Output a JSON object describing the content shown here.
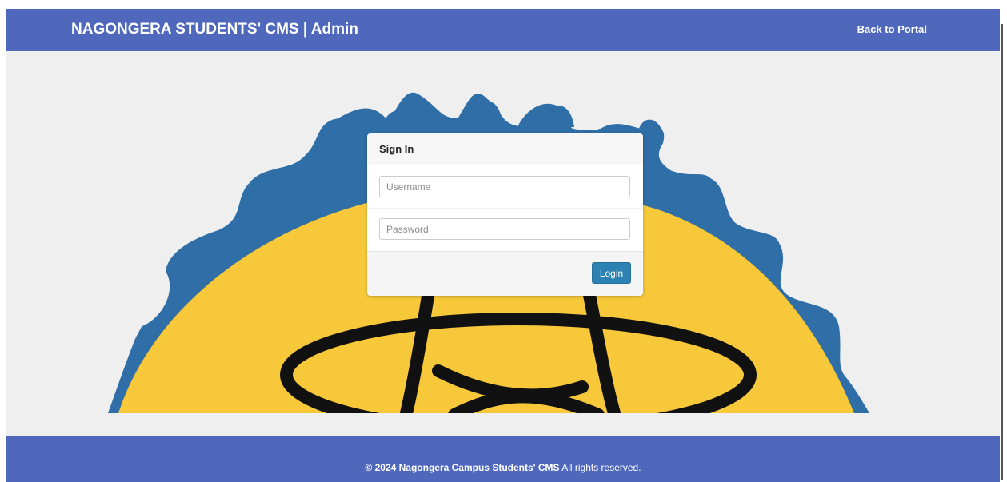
{
  "header": {
    "brand": "NAGONGERA STUDENTS' CMS | Admin",
    "back_link": "Back to Portal"
  },
  "login_card": {
    "title": "Sign In",
    "username_placeholder": "Username",
    "password_placeholder": "Password",
    "login_button": "Login"
  },
  "footer": {
    "copyright_bold": "© 2024 Nagongera Campus Students' CMS",
    "copyright_rest": " All rights reserved."
  },
  "colors": {
    "brand_bar": "#4f68bc",
    "page_bg": "#efefef",
    "gear_blue": "#2f6ea6",
    "emblem_yellow": "#f7c83a",
    "login_button": "#2c83b3"
  },
  "icons": {
    "background": "gear-atom-emblem"
  }
}
